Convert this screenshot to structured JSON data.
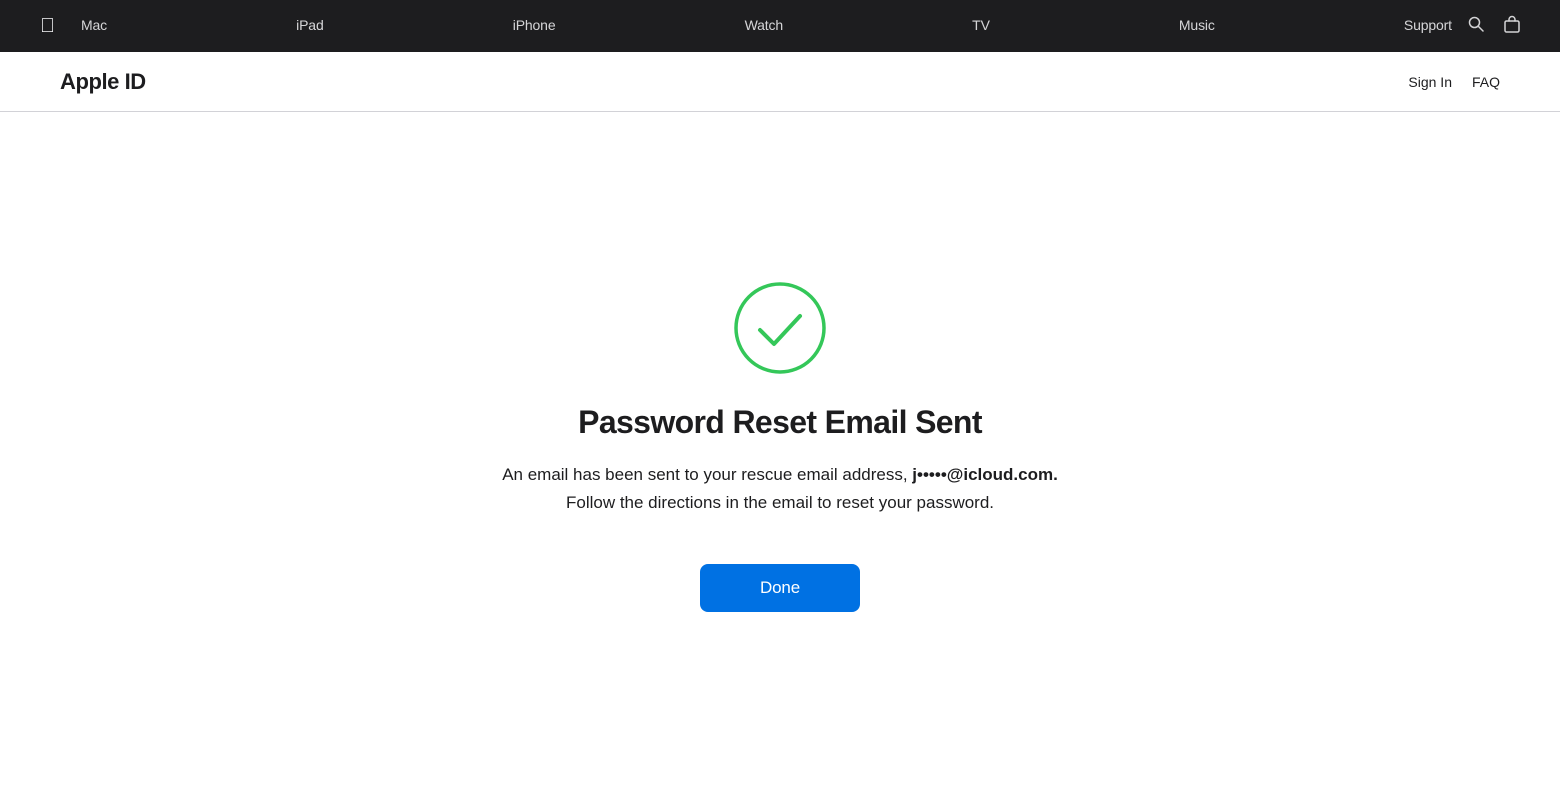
{
  "nav": {
    "apple_logo": "🍎",
    "items": [
      {
        "label": "Mac",
        "id": "mac"
      },
      {
        "label": "iPad",
        "id": "ipad"
      },
      {
        "label": "iPhone",
        "id": "iphone"
      },
      {
        "label": "Watch",
        "id": "watch"
      },
      {
        "label": "TV",
        "id": "tv"
      },
      {
        "label": "Music",
        "id": "music"
      },
      {
        "label": "Support",
        "id": "support"
      }
    ],
    "search_icon": "🔍",
    "bag_icon": "🛍"
  },
  "sub_header": {
    "title": "Apple ID",
    "sign_in_label": "Sign In",
    "faq_label": "FAQ"
  },
  "main": {
    "success_title": "Password Reset Email Sent",
    "description_prefix": "An email has been sent to your rescue email address, ",
    "email_address": "j•••••@icloud.com.",
    "description_suffix": " Follow the directions in the email to reset your password.",
    "done_button_label": "Done",
    "success_color": "#34c759"
  }
}
